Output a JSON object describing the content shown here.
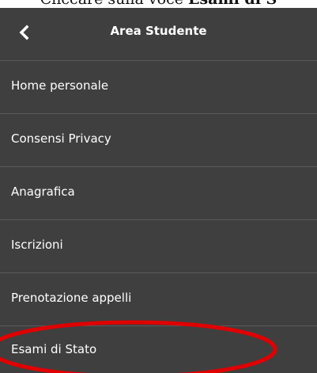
{
  "caption": {
    "prefix": "Cliccare sulla voce ",
    "bold": "Esami di S"
  },
  "header": {
    "title": "Area Studente",
    "back_icon": "chevron-left-icon"
  },
  "menu": {
    "items": [
      {
        "label": "Home personale"
      },
      {
        "label": "Consensi Privacy"
      },
      {
        "label": "Anagrafica"
      },
      {
        "label": "Iscrizioni"
      },
      {
        "label": "Prenotazione appelli"
      },
      {
        "label": "Esami di Stato",
        "highlighted": true
      }
    ]
  },
  "colors": {
    "panel_background": "#3f3f3f",
    "divider": "#5a5a5a",
    "text": "#ffffff",
    "highlight_ring": "#e00000"
  }
}
